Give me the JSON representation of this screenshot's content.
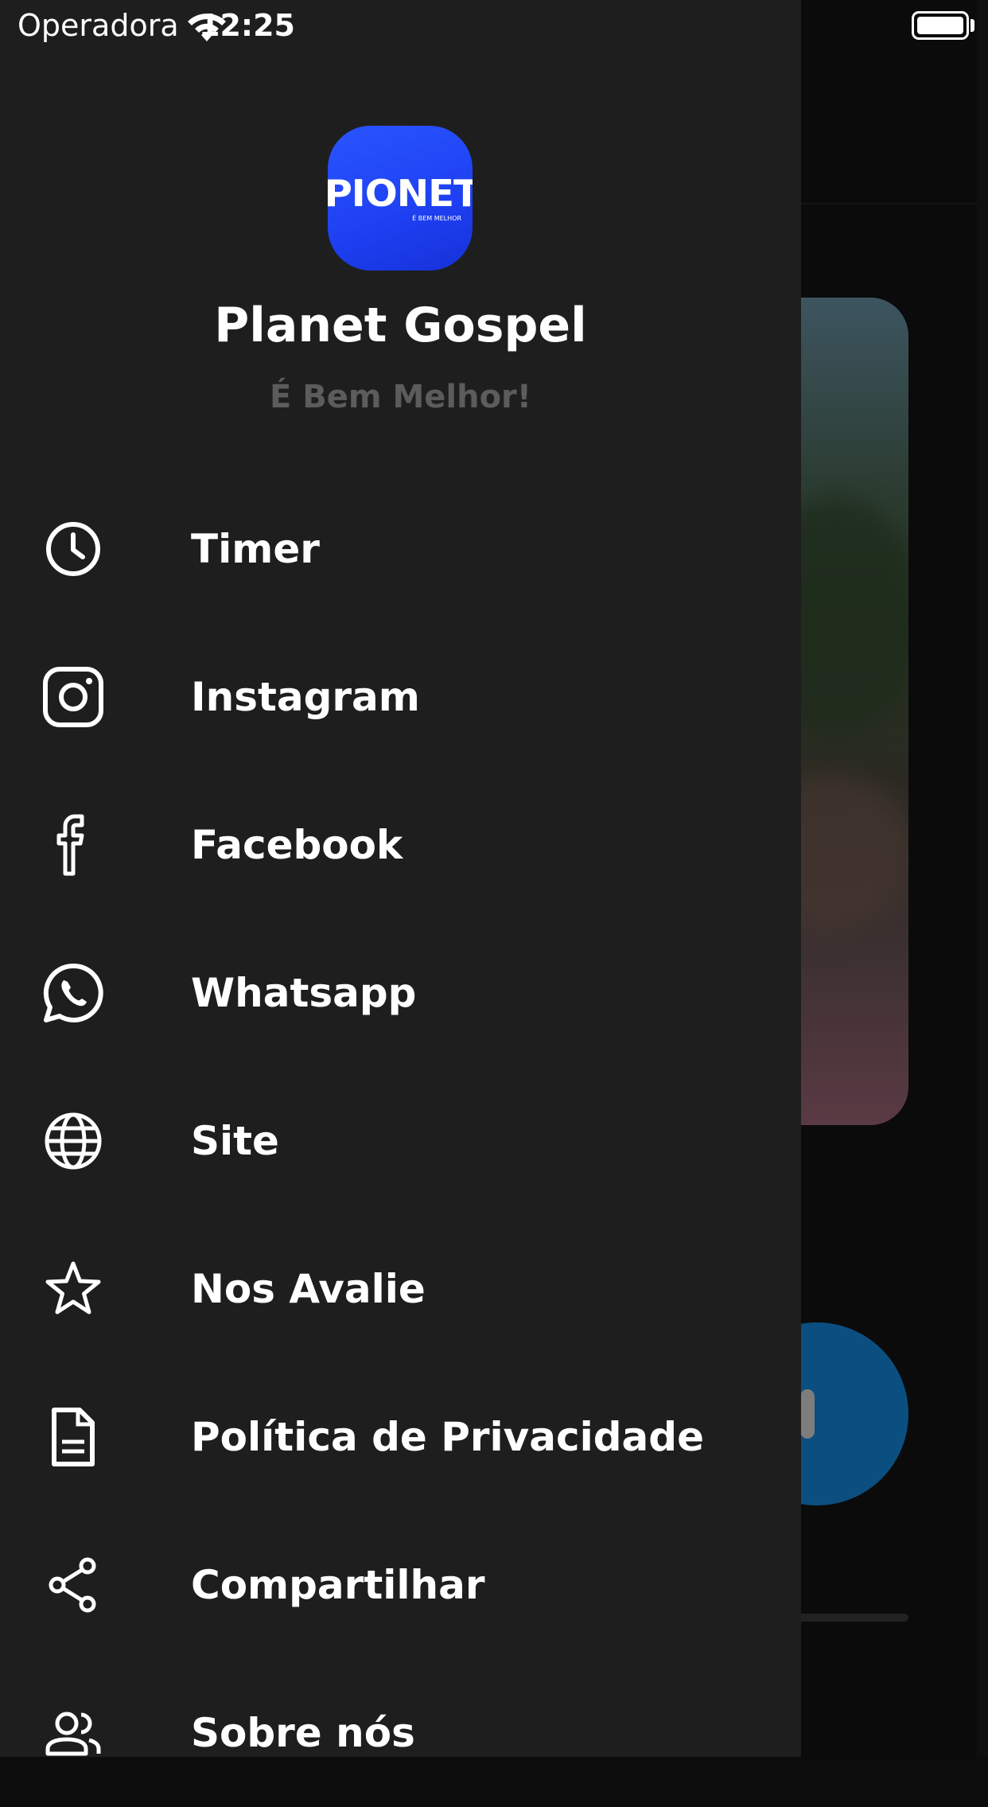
{
  "status_bar": {
    "carrier": "Operadora",
    "time": "12:25",
    "wifi_icon": "wifi-icon",
    "battery_icon": "battery-icon"
  },
  "drawer": {
    "logo": {
      "text": "PIONET",
      "tagline": "É BEM MELHOR",
      "icon": "app-logo",
      "color": "#2447f5"
    },
    "title": "Planet Gospel",
    "subtitle": "É Bem Melhor!",
    "items": [
      {
        "label": "Timer",
        "icon": "clock-icon"
      },
      {
        "label": "Instagram",
        "icon": "instagram-icon"
      },
      {
        "label": "Facebook",
        "icon": "facebook-icon"
      },
      {
        "label": "Whatsapp",
        "icon": "whatsapp-icon"
      },
      {
        "label": "Site",
        "icon": "globe-icon"
      },
      {
        "label": "Nos Avalie",
        "icon": "star-icon"
      },
      {
        "label": "Política de Privacidade",
        "icon": "document-icon"
      },
      {
        "label": "Compartilhar",
        "icon": "share-icon"
      },
      {
        "label": "Sobre nós",
        "icon": "people-icon"
      }
    ]
  },
  "background_player": {
    "play_button_color": "#0a4f7f",
    "pause_icon": "pause-icon"
  }
}
